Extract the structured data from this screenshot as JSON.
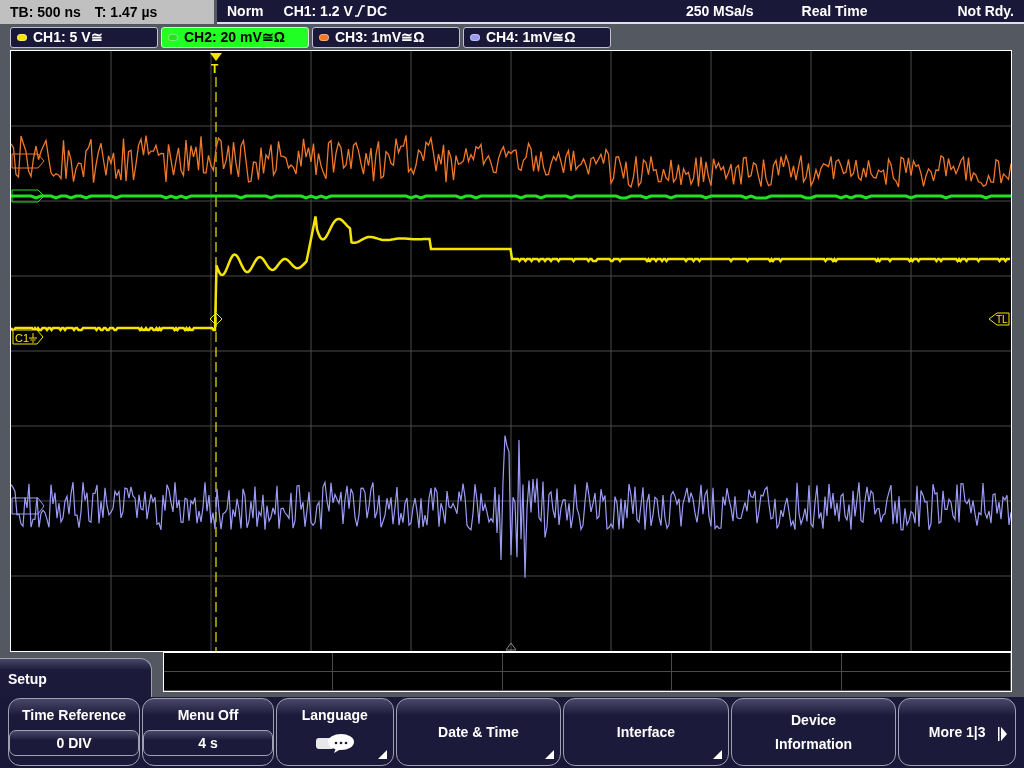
{
  "status_bar": {
    "timebase": "TB: 500 ns",
    "trigger_time": "T: 1.47 µs",
    "mode": "Norm",
    "trigger_level": "CH1: 1.2 V",
    "coupling": "DC",
    "sample_rate": "250 MSa/s",
    "acquisition": "Real Time",
    "status": "Not Rdy."
  },
  "channels": [
    {
      "label": "CH1: 5 V≅",
      "color": "#f5e400",
      "selected": false
    },
    {
      "label": "CH2: 20 mV≅Ω",
      "color": "#22e022",
      "selected": true
    },
    {
      "label": "CH3: 1mV≅Ω",
      "color": "#f07828",
      "selected": false
    },
    {
      "label": "CH4: 1mV≅Ω",
      "color": "#9b9bf5",
      "selected": false
    }
  ],
  "plot": {
    "trigger_marker": "T",
    "ch1_marker": "C1",
    "trigger_level_marker": "TL"
  },
  "menu": {
    "title": "Setup",
    "softkeys": [
      {
        "kind": "value",
        "label": "Time Reference",
        "value": "0 DIV"
      },
      {
        "kind": "value",
        "label": "Menu Off",
        "value": "4 s"
      },
      {
        "kind": "icon",
        "label": "Language",
        "submenu": true
      },
      {
        "kind": "plain",
        "label": "Date & Time",
        "submenu": true
      },
      {
        "kind": "plain",
        "label": "Interface",
        "submenu": true
      },
      {
        "kind": "plain",
        "label": "Device Information",
        "submenu": false
      },
      {
        "kind": "next",
        "label": "More 1|3"
      }
    ]
  }
}
